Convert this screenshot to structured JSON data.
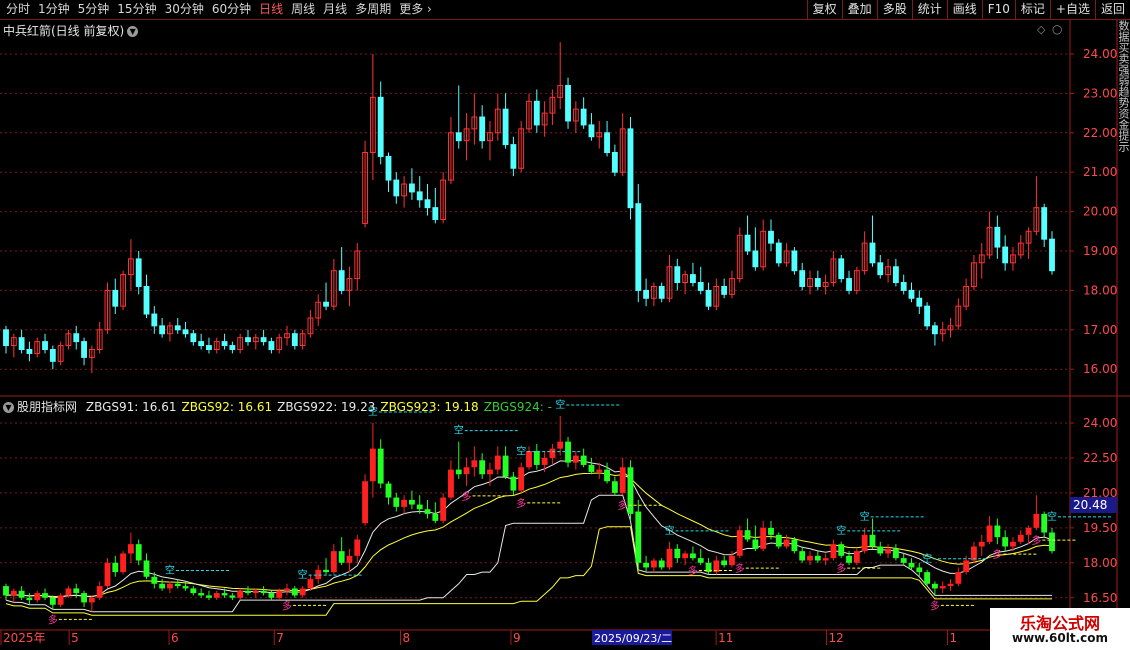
{
  "toolbar": {
    "period_tabs": [
      "分时",
      "1分钟",
      "5分钟",
      "15分钟",
      "30分钟",
      "60分钟",
      "日线",
      "周线",
      "月线",
      "多周期",
      "更多 ›"
    ],
    "active_tab": "日线",
    "buttons": [
      "复权",
      "叠加",
      "多股",
      "统计",
      "画线",
      "F10",
      "标记",
      "+自选",
      "返回"
    ]
  },
  "main_panel": {
    "title": "中兵红箭(日线 前复权)",
    "price_axis": [
      "24.00",
      "23.00",
      "22.00",
      "21.00",
      "20.00",
      "19.00",
      "18.00",
      "17.00",
      "16.00"
    ]
  },
  "indicator_panel": {
    "name": "股朋指标网",
    "legend": [
      {
        "label": "ZBGS91: 16.61",
        "color": "#e8e8e8"
      },
      {
        "label": "ZBGS92: 16.61",
        "color": "#ffff33"
      },
      {
        "label": "ZBGS922: 19.23",
        "color": "#e8e8e8"
      },
      {
        "label": "ZBGS923: 19.18",
        "color": "#ffff33"
      },
      {
        "label": "ZBGS924: -",
        "color": "#33cc33"
      }
    ],
    "price_axis": [
      "24.00",
      "22.50",
      "21.00",
      "19.50",
      "18.00",
      "16.50"
    ],
    "current_price": "20.48",
    "markers": {
      "sell": "空",
      "buy": "多"
    }
  },
  "date_axis": {
    "labels": [
      "2025年",
      "5",
      "6",
      "7",
      "8",
      "9",
      "11",
      "12",
      "1"
    ],
    "cursor_date": "2025/09/23/二"
  },
  "side_strip_text": "数据买卖强弱趋势资金提示",
  "watermark": {
    "line1": "乐淘公式网",
    "line2": "www.60lt.com"
  },
  "colors": {
    "up": "#ff3333",
    "down": "#54ffff",
    "ind_up": "#ff2020",
    "ind_down": "#22ff22",
    "grid": "#7a1a1a",
    "axis_text": "#ff4a4a"
  },
  "chart_data": {
    "type": "candlestick",
    "title": "中兵红箭(日线 前复权)",
    "ylim": [
      15.6,
      24.6
    ],
    "ohlc": [
      [
        17.0,
        17.1,
        16.4,
        16.6
      ],
      [
        16.6,
        16.9,
        16.3,
        16.8
      ],
      [
        16.8,
        17.0,
        16.4,
        16.5
      ],
      [
        16.5,
        16.7,
        16.2,
        16.4
      ],
      [
        16.4,
        16.8,
        16.3,
        16.7
      ],
      [
        16.7,
        16.9,
        16.4,
        16.5
      ],
      [
        16.5,
        16.6,
        16.0,
        16.2
      ],
      [
        16.2,
        16.7,
        16.1,
        16.6
      ],
      [
        16.6,
        17.0,
        16.5,
        16.9
      ],
      [
        16.9,
        17.1,
        16.5,
        16.7
      ],
      [
        16.7,
        16.8,
        16.1,
        16.3
      ],
      [
        16.3,
        16.6,
        15.9,
        16.5
      ],
      [
        16.5,
        17.2,
        16.4,
        17.0
      ],
      [
        17.0,
        18.2,
        16.9,
        18.0
      ],
      [
        18.0,
        18.3,
        17.4,
        17.6
      ],
      [
        17.6,
        18.5,
        17.5,
        18.4
      ],
      [
        18.4,
        19.3,
        18.0,
        18.8
      ],
      [
        18.8,
        19.0,
        17.9,
        18.1
      ],
      [
        18.1,
        18.4,
        17.3,
        17.4
      ],
      [
        17.4,
        17.6,
        16.9,
        17.1
      ],
      [
        17.1,
        17.3,
        16.8,
        16.9
      ],
      [
        16.9,
        17.2,
        16.7,
        17.1
      ],
      [
        17.1,
        17.3,
        16.9,
        17.0
      ],
      [
        17.0,
        17.2,
        16.8,
        16.9
      ],
      [
        16.9,
        17.0,
        16.6,
        16.7
      ],
      [
        16.7,
        16.9,
        16.5,
        16.6
      ],
      [
        16.6,
        16.8,
        16.4,
        16.5
      ],
      [
        16.5,
        16.8,
        16.4,
        16.7
      ],
      [
        16.7,
        16.9,
        16.5,
        16.6
      ],
      [
        16.6,
        16.7,
        16.4,
        16.5
      ],
      [
        16.5,
        16.9,
        16.4,
        16.8
      ],
      [
        16.8,
        17.0,
        16.6,
        16.7
      ],
      [
        16.7,
        16.9,
        16.5,
        16.8
      ],
      [
        16.8,
        17.0,
        16.6,
        16.7
      ],
      [
        16.7,
        16.8,
        16.4,
        16.5
      ],
      [
        16.5,
        16.9,
        16.4,
        16.8
      ],
      [
        16.8,
        17.1,
        16.6,
        16.9
      ],
      [
        16.9,
        17.0,
        16.5,
        16.6
      ],
      [
        16.6,
        17.0,
        16.5,
        16.9
      ],
      [
        16.9,
        17.5,
        16.8,
        17.3
      ],
      [
        17.3,
        17.9,
        17.1,
        17.7
      ],
      [
        17.7,
        18.2,
        17.5,
        17.6
      ],
      [
        17.6,
        18.8,
        17.5,
        18.5
      ],
      [
        18.5,
        19.1,
        17.9,
        18.0
      ],
      [
        18.0,
        18.6,
        17.6,
        18.3
      ],
      [
        18.3,
        19.2,
        18.0,
        19.0
      ],
      [
        19.7,
        21.8,
        19.6,
        21.5
      ],
      [
        21.5,
        24.0,
        20.8,
        22.9
      ],
      [
        22.9,
        23.3,
        21.2,
        21.4
      ],
      [
        21.4,
        21.5,
        20.5,
        20.8
      ],
      [
        20.8,
        21.0,
        20.2,
        20.4
      ],
      [
        20.4,
        20.9,
        20.1,
        20.7
      ],
      [
        20.7,
        21.1,
        20.3,
        20.5
      ],
      [
        20.5,
        20.9,
        20.1,
        20.3
      ],
      [
        20.3,
        20.7,
        19.9,
        20.1
      ],
      [
        20.1,
        20.6,
        19.7,
        19.8
      ],
      [
        19.8,
        21.0,
        19.7,
        20.8
      ],
      [
        20.8,
        22.4,
        20.7,
        22.0
      ],
      [
        22.0,
        23.2,
        21.6,
        21.8
      ],
      [
        21.8,
        22.5,
        21.3,
        22.1
      ],
      [
        22.1,
        23.0,
        21.7,
        22.4
      ],
      [
        22.4,
        22.7,
        21.6,
        21.8
      ],
      [
        21.8,
        22.3,
        21.3,
        22.0
      ],
      [
        22.0,
        23.0,
        21.8,
        22.6
      ],
      [
        22.6,
        23.0,
        21.6,
        21.7
      ],
      [
        21.7,
        21.9,
        20.9,
        21.1
      ],
      [
        21.1,
        22.3,
        21.0,
        22.1
      ],
      [
        22.1,
        23.0,
        22.0,
        22.8
      ],
      [
        22.8,
        23.1,
        22.0,
        22.2
      ],
      [
        22.2,
        22.8,
        21.9,
        22.5
      ],
      [
        22.5,
        23.1,
        22.2,
        22.9
      ],
      [
        22.9,
        24.3,
        22.6,
        23.2
      ],
      [
        23.2,
        23.4,
        22.1,
        22.3
      ],
      [
        22.3,
        22.8,
        22.0,
        22.6
      ],
      [
        22.6,
        22.9,
        22.1,
        22.2
      ],
      [
        22.2,
        22.5,
        21.8,
        21.9
      ],
      [
        21.9,
        22.3,
        21.6,
        22.0
      ],
      [
        22.0,
        22.3,
        21.4,
        21.5
      ],
      [
        21.5,
        21.7,
        20.9,
        21.0
      ],
      [
        21.0,
        22.5,
        20.9,
        22.1
      ],
      [
        22.1,
        22.4,
        19.8,
        20.1
      ],
      [
        20.2,
        20.7,
        17.7,
        18.0
      ],
      [
        18.0,
        18.3,
        17.6,
        17.8
      ],
      [
        17.8,
        18.2,
        17.6,
        18.1
      ],
      [
        18.1,
        18.2,
        17.7,
        17.8
      ],
      [
        17.8,
        18.9,
        17.7,
        18.6
      ],
      [
        18.6,
        18.8,
        18.0,
        18.2
      ],
      [
        18.2,
        18.5,
        17.9,
        18.4
      ],
      [
        18.4,
        18.7,
        18.1,
        18.2
      ],
      [
        18.2,
        18.6,
        17.9,
        18.0
      ],
      [
        18.0,
        18.2,
        17.5,
        17.6
      ],
      [
        17.6,
        18.3,
        17.5,
        18.1
      ],
      [
        18.1,
        18.3,
        17.8,
        17.9
      ],
      [
        17.9,
        18.5,
        17.8,
        18.3
      ],
      [
        18.3,
        19.6,
        18.2,
        19.4
      ],
      [
        19.4,
        19.9,
        18.9,
        19.0
      ],
      [
        19.0,
        19.6,
        18.5,
        18.6
      ],
      [
        18.6,
        19.8,
        18.5,
        19.5
      ],
      [
        19.5,
        19.8,
        19.0,
        19.2
      ],
      [
        19.2,
        19.3,
        18.6,
        18.7
      ],
      [
        18.7,
        19.2,
        18.6,
        19.0
      ],
      [
        19.0,
        19.1,
        18.4,
        18.5
      ],
      [
        18.5,
        18.7,
        18.0,
        18.1
      ],
      [
        18.1,
        18.5,
        17.9,
        18.3
      ],
      [
        18.3,
        18.5,
        18.0,
        18.1
      ],
      [
        18.1,
        18.4,
        17.9,
        18.2
      ],
      [
        18.2,
        19.0,
        18.1,
        18.8
      ],
      [
        18.8,
        18.9,
        18.2,
        18.3
      ],
      [
        18.3,
        18.5,
        17.9,
        18.0
      ],
      [
        18.0,
        18.6,
        17.9,
        18.5
      ],
      [
        18.5,
        19.5,
        18.4,
        19.2
      ],
      [
        19.2,
        19.9,
        18.6,
        18.7
      ],
      [
        18.7,
        18.9,
        18.3,
        18.4
      ],
      [
        18.4,
        18.8,
        18.2,
        18.6
      ],
      [
        18.6,
        18.8,
        18.1,
        18.2
      ],
      [
        18.2,
        18.4,
        17.9,
        18.0
      ],
      [
        18.0,
        18.2,
        17.7,
        17.8
      ],
      [
        17.8,
        18.0,
        17.4,
        17.6
      ],
      [
        17.6,
        17.7,
        17.0,
        17.1
      ],
      [
        17.1,
        17.2,
        16.6,
        16.9
      ],
      [
        16.9,
        17.2,
        16.7,
        17.0
      ],
      [
        17.0,
        17.3,
        16.8,
        17.1
      ],
      [
        17.1,
        17.8,
        17.0,
        17.6
      ],
      [
        17.6,
        18.3,
        17.5,
        18.1
      ],
      [
        18.1,
        18.9,
        18.0,
        18.7
      ],
      [
        18.7,
        19.2,
        18.3,
        18.9
      ],
      [
        18.9,
        20.0,
        18.8,
        19.6
      ],
      [
        19.6,
        19.9,
        18.8,
        19.1
      ],
      [
        19.1,
        19.4,
        18.5,
        18.7
      ],
      [
        18.7,
        19.1,
        18.5,
        18.9
      ],
      [
        18.9,
        19.4,
        18.8,
        19.2
      ],
      [
        19.2,
        19.6,
        18.8,
        19.5
      ],
      [
        19.5,
        20.9,
        19.4,
        20.1
      ],
      [
        20.1,
        20.2,
        19.1,
        19.3
      ],
      [
        19.3,
        19.5,
        18.4,
        18.5
      ]
    ],
    "indicator_lines": [
      {
        "name": "ZBGS922",
        "color": "#e8e8e8"
      },
      {
        "name": "ZBGS923",
        "color": "#ffff33"
      },
      {
        "name": "ZBGS91",
        "color": "#e8e8e8"
      },
      {
        "name": "ZBGS92",
        "color": "#ffff33"
      }
    ]
  }
}
